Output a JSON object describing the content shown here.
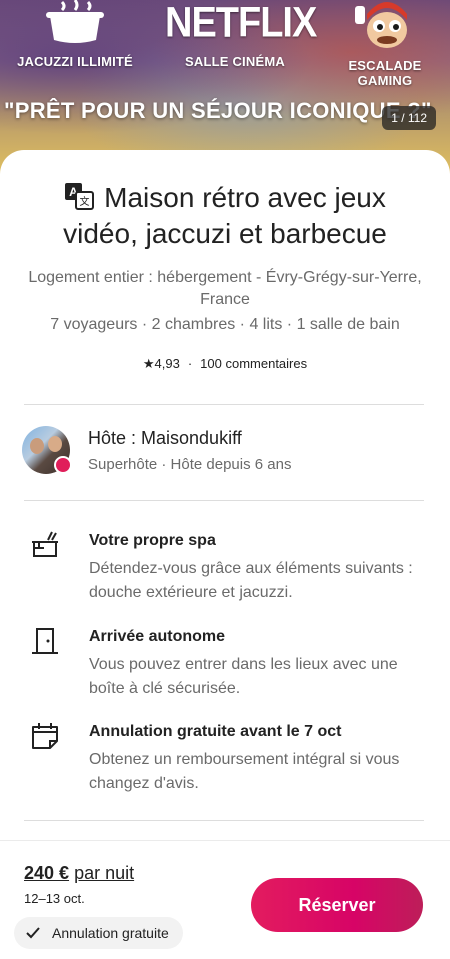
{
  "hero": {
    "features": [
      {
        "label": "JACUZZI ILLIMITÉ",
        "icon": "hot-tub-icon"
      },
      {
        "logo": "NETFLIX",
        "label": "SALLE CINÉMA"
      },
      {
        "label_line1": "ESCALADE",
        "label_line2": "GAMING",
        "icon": "gaming-character-icon"
      }
    ],
    "tagline": "\"PRÊT POUR UN SÉJOUR ICONIQUE ?\"",
    "photo_counter": "1 / 112"
  },
  "listing": {
    "title": "Maison rétro avec jeux vidéo, jaccuzi et barbecue",
    "subtitle": "Logement entier : hébergement - Évry-Grégy-sur-Yerre, France",
    "specs": "7 voyageurs · 2 chambres · 4 lits · 1 salle de bain",
    "rating": "4,93",
    "reviews": "100 commentaires"
  },
  "host": {
    "name": "Hôte : Maisondukiff",
    "subtitle": "Superhôte · Hôte depuis 6 ans"
  },
  "amenities": [
    {
      "icon": "spa-icon",
      "title": "Votre propre spa",
      "desc": "Détendez-vous grâce aux éléments suivants : douche extérieure et jacuzzi."
    },
    {
      "icon": "door-icon",
      "title": "Arrivée autonome",
      "desc": "Vous pouvez entrer dans les lieux avec une boîte à clé sécurisée."
    },
    {
      "icon": "calendar-icon",
      "title": "Annulation gratuite avant le 7 oct",
      "desc": "Obtenez un remboursement intégral si vous changez d'avis."
    }
  ],
  "footer": {
    "price": "240 €",
    "per_night": "par nuit",
    "dates": "12–13 oct.",
    "free_cancellation": "Annulation gratuite",
    "reserve_label": "Réserver"
  },
  "colors": {
    "brand": "#e31c5f",
    "text": "#222222",
    "muted": "#6a6a6a",
    "divider": "#dddddd"
  }
}
